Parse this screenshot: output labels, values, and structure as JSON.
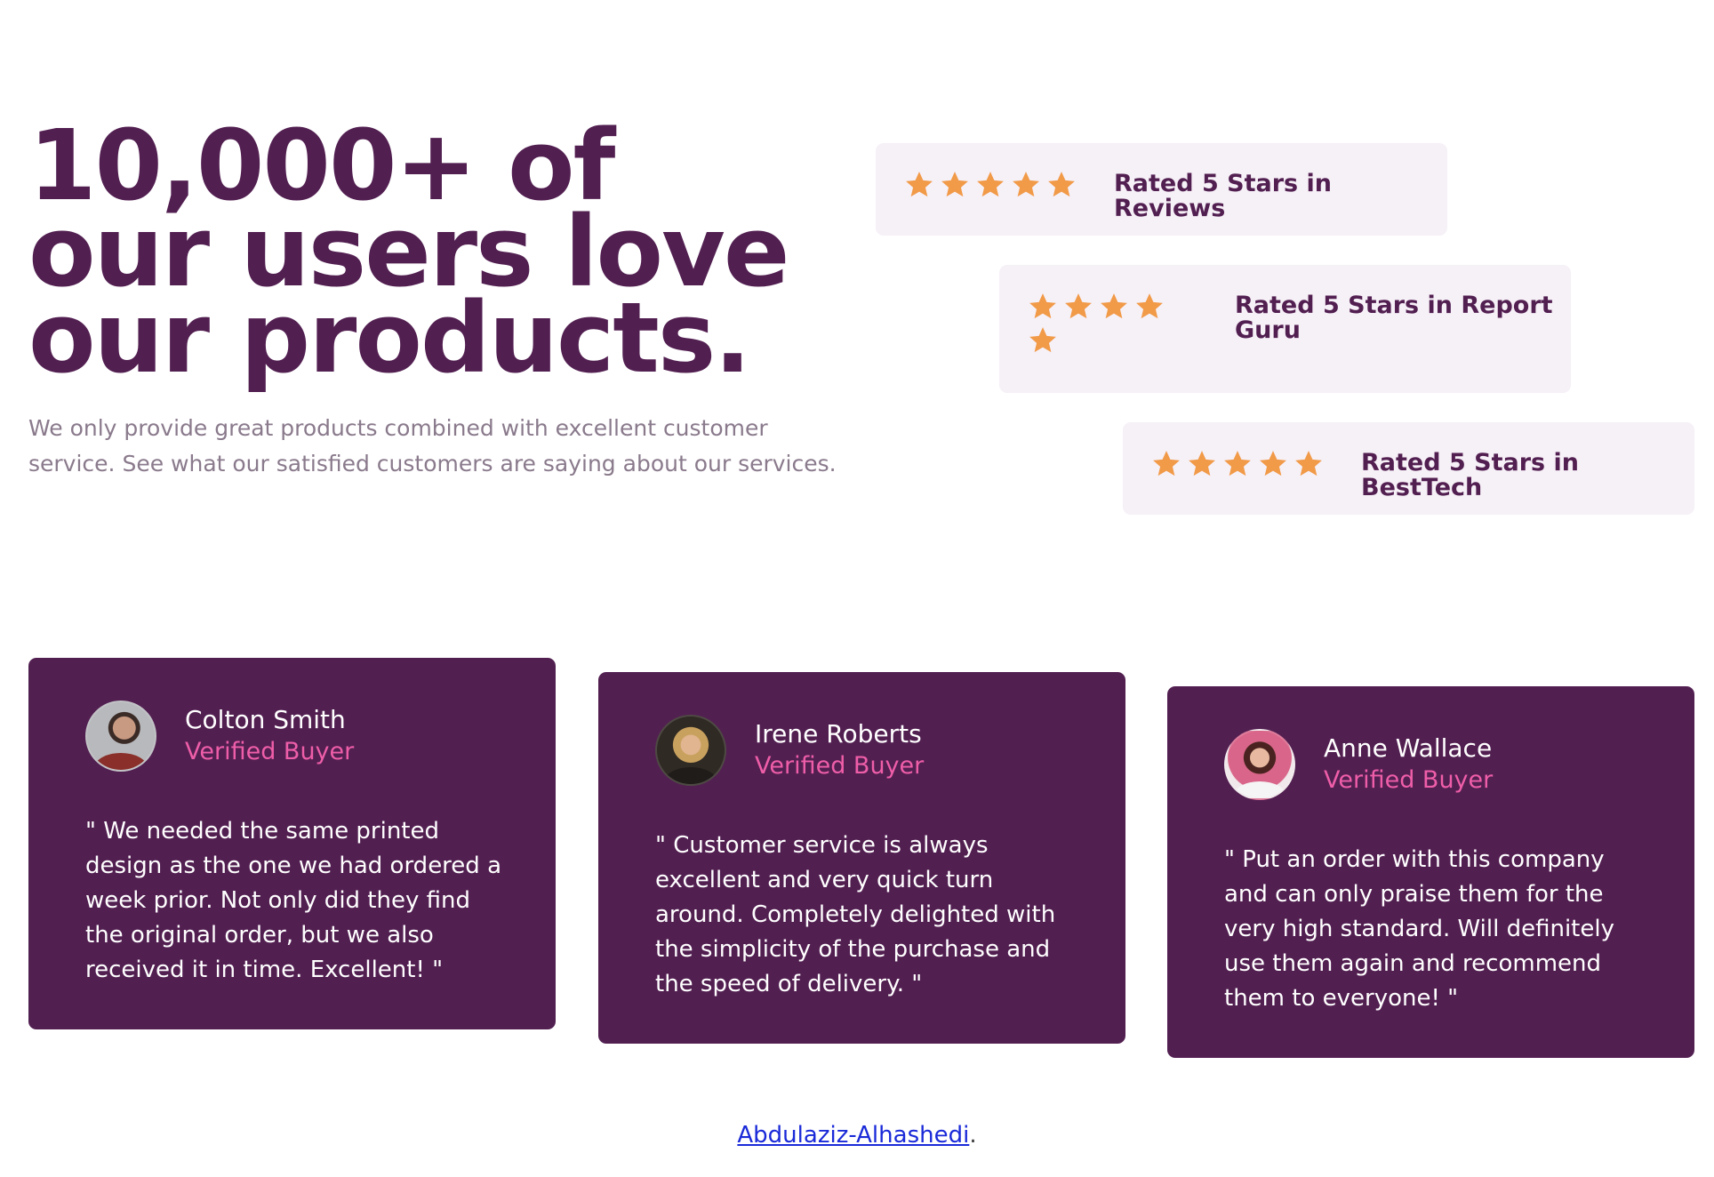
{
  "hero": {
    "title": "10,000+ of our users love our products.",
    "subtitle": "We only provide great products combined with excellent customer service. See what our satisfied customers are saying about our services."
  },
  "ratings": [
    {
      "stars": 5,
      "label": "Rated 5 Stars in Reviews"
    },
    {
      "stars": 5,
      "label": "Rated 5 Stars in Report Guru"
    },
    {
      "stars": 5,
      "label": "Rated 5 Stars in BestTech"
    }
  ],
  "testimonials": [
    {
      "name": "Colton Smith",
      "role": "Verified Buyer",
      "quote": "\" We needed the same printed design as the one we had ordered a week prior. Not only did they find the original order, but we also received it in time. Excellent! \"",
      "avatar_icon": "avatar-colton-smith"
    },
    {
      "name": "Irene Roberts",
      "role": "Verified Buyer",
      "quote": "\" Customer service is always excellent and very quick turn around. Completely delighted with the simplicity of the purchase and the speed of delivery. \"",
      "avatar_icon": "avatar-irene-roberts"
    },
    {
      "name": "Anne Wallace",
      "role": "Verified Buyer",
      "quote": "\" Put an order with this company and can only praise them for the very high standard. Will definitely use them again and recommend them to everyone! \"",
      "avatar_icon": "avatar-anne-wallace"
    }
  ],
  "footer": {
    "credit_link": "Abdulaziz-Alhashedi",
    "credit_suffix": "."
  },
  "colors": {
    "primary": "#521f51",
    "accent_pink": "#ee5ea8",
    "star_orange": "#f19a48",
    "rating_bg": "#f6f0f7",
    "subtitle_gray": "#8a7a8c",
    "link_blue": "#1a2ad8"
  }
}
